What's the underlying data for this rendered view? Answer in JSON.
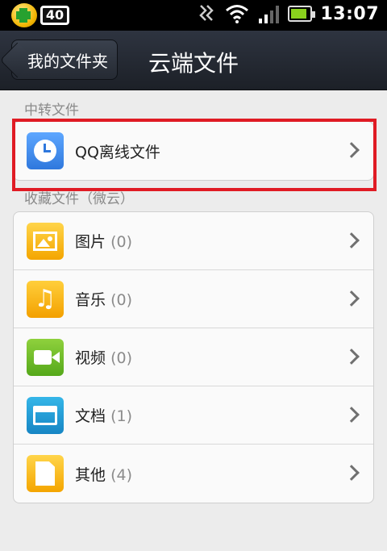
{
  "status": {
    "time": "13:07",
    "badge": "40"
  },
  "header": {
    "back_label": "我的文件夹",
    "title": "云端文件"
  },
  "sections": [
    {
      "label": "中转文件",
      "items": [
        {
          "name": "QQ离线文件",
          "count": ""
        }
      ]
    },
    {
      "label": "收藏文件（微云）",
      "items": [
        {
          "name": "图片",
          "count": "(0)"
        },
        {
          "name": "音乐",
          "count": "(0)"
        },
        {
          "name": "视频",
          "count": "(0)"
        },
        {
          "name": "文档",
          "count": "(1)"
        },
        {
          "name": "其他",
          "count": "(4)"
        }
      ]
    }
  ],
  "icons": {
    "offline": "clock-icon",
    "pictures": "picture-icon",
    "music": "music-note-icon",
    "music_glyph": "♫",
    "video": "video-camera-icon",
    "docs": "folder-icon",
    "other": "document-icon"
  }
}
